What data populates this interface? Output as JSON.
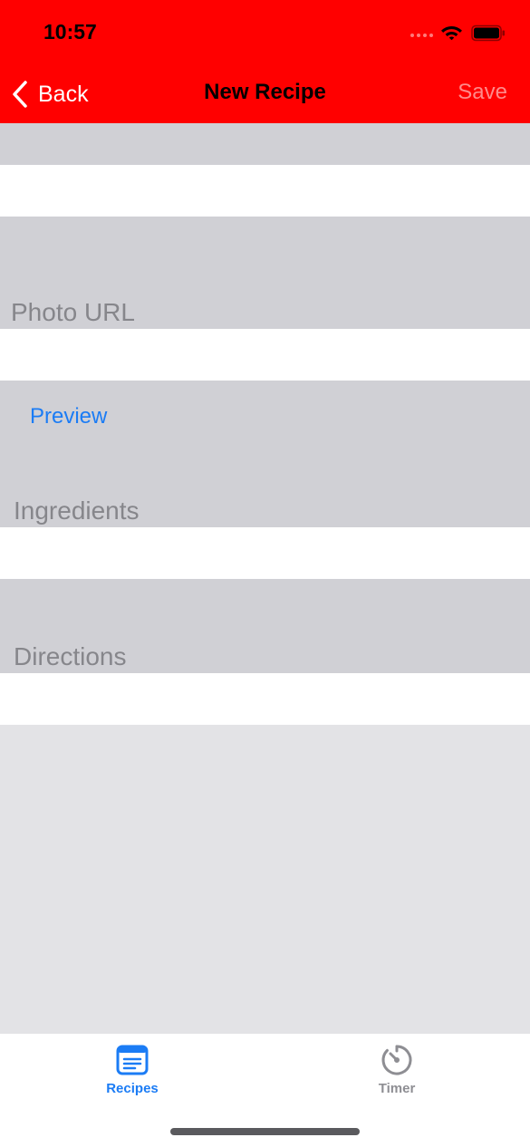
{
  "colors": {
    "nav_background": "#ff0000",
    "section_header": "#d0d0d5",
    "page_background": "#e3e3e6",
    "accent_blue": "#1b7cf5",
    "save_disabled": "#ff8a8a",
    "tab_inactive": "#8e8e93"
  },
  "status_bar": {
    "time": "10:57",
    "icons": [
      "signal-icon",
      "wifi-icon",
      "battery-icon"
    ]
  },
  "nav": {
    "back_label": "Back",
    "title": "New Recipe",
    "save_label": "Save"
  },
  "form": {
    "name_field": {
      "value": "",
      "placeholder": ""
    },
    "photo_url_label": "Photo URL",
    "photo_url_field": {
      "value": "",
      "placeholder": ""
    },
    "preview_label": "Preview",
    "ingredients_label": "Ingredients",
    "ingredients_field": {
      "value": "",
      "placeholder": ""
    },
    "directions_label": "Directions",
    "directions_field": {
      "value": "",
      "placeholder": ""
    }
  },
  "tab_bar": {
    "tabs": [
      {
        "label": "Recipes",
        "icon": "recipes-icon",
        "selected": true
      },
      {
        "label": "Timer",
        "icon": "timer-icon",
        "selected": false
      }
    ]
  }
}
